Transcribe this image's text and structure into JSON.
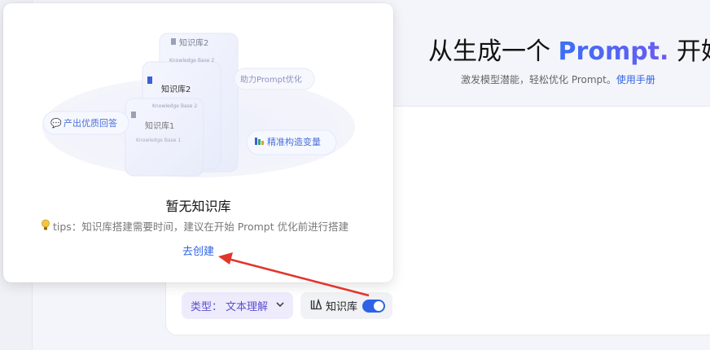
{
  "hero": {
    "title_prefix": "从生成一个 ",
    "title_brand": "Prompt.",
    "title_suffix": " 开始",
    "subtitle": "激发模型潜能，轻松优化 Prompt。",
    "manual_link": "使用手册"
  },
  "popover": {
    "empty_title": "暂无知识库",
    "tips": "tips：知识库搭建需要时间，建议在开始 Prompt 优化前进行搭建",
    "create_link": "去创建",
    "illustration": {
      "cards": [
        {
          "title": "知识库2",
          "subtitle": "Knowledge Base 2"
        },
        {
          "title": "知识库2",
          "subtitle": "Knowledge Base 2"
        },
        {
          "title": "知识库1",
          "subtitle": "Knowledge Base 1"
        }
      ],
      "tag_boost": "助力Prompt优化",
      "tag_answer": "产出优质回答",
      "tag_variable": "精准构造变量"
    }
  },
  "composer": {
    "type_label": "类型：",
    "type_value": "文本理解",
    "kb_label": "知识库",
    "kb_enabled": true
  },
  "colors": {
    "accent": "#2f63e6",
    "type_chip_bg": "#eeecfc",
    "arrow": "#e2352b"
  }
}
